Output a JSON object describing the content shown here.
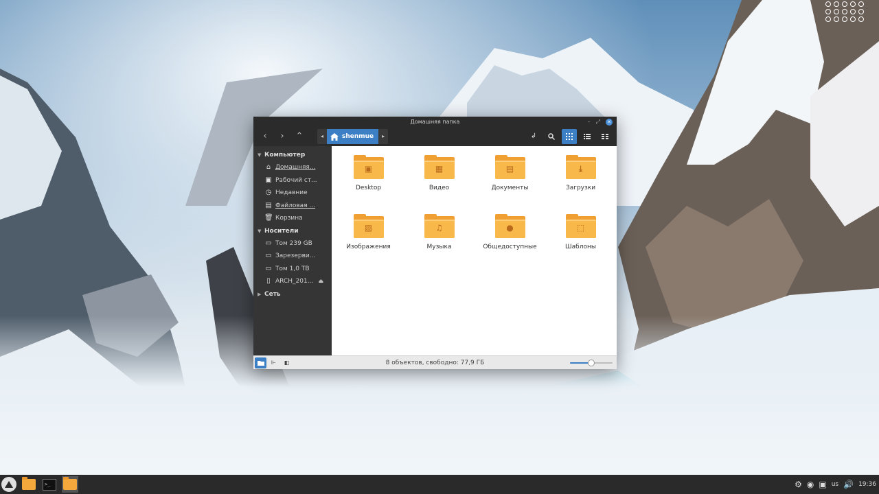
{
  "window": {
    "title": "Домашняя папка"
  },
  "toolbar": {
    "back_glyph": "‹",
    "forward_glyph": "›",
    "up_glyph": "⌃",
    "path_left_glyph": "◂",
    "path_right_glyph": "▸",
    "crumb": "shenmue"
  },
  "sidebar": {
    "sections": [
      {
        "label": "Компьютер",
        "items": [
          {
            "label": "Домашняя...",
            "icon": "home-icon"
          },
          {
            "label": "Рабочий ст...",
            "icon": "desktop-icon"
          },
          {
            "label": "Недавние",
            "icon": "recent-icon"
          },
          {
            "label": "Файловая ...",
            "icon": "drive-icon"
          },
          {
            "label": "Корзина",
            "icon": "trash-icon"
          }
        ]
      },
      {
        "label": "Носители",
        "items": [
          {
            "label": "Том 239 GB",
            "icon": "disk-icon"
          },
          {
            "label": "Зарезерви...",
            "icon": "disk-icon"
          },
          {
            "label": "Том 1,0 TB",
            "icon": "disk-icon"
          },
          {
            "label": "ARCH_201...",
            "icon": "usb-icon"
          }
        ]
      },
      {
        "label": "Сеть",
        "items": []
      }
    ]
  },
  "files": [
    {
      "name": "Desktop",
      "emblem": "desktop"
    },
    {
      "name": "Видео",
      "emblem": "video"
    },
    {
      "name": "Документы",
      "emblem": "document"
    },
    {
      "name": "Загрузки",
      "emblem": "download"
    },
    {
      "name": "Изображения",
      "emblem": "image"
    },
    {
      "name": "Музыка",
      "emblem": "music"
    },
    {
      "name": "Общедоступные",
      "emblem": "users"
    },
    {
      "name": "Шаблоны",
      "emblem": "template"
    }
  ],
  "statusbar": {
    "text": "8 объектов, свободно: 77,9 ГБ",
    "zoom_fraction": 0.5
  },
  "taskbar": {
    "kbd_layout": "us",
    "clock": "19:36"
  },
  "colors": {
    "accent": "#3d7fc4",
    "folder": "#f9b84a"
  }
}
